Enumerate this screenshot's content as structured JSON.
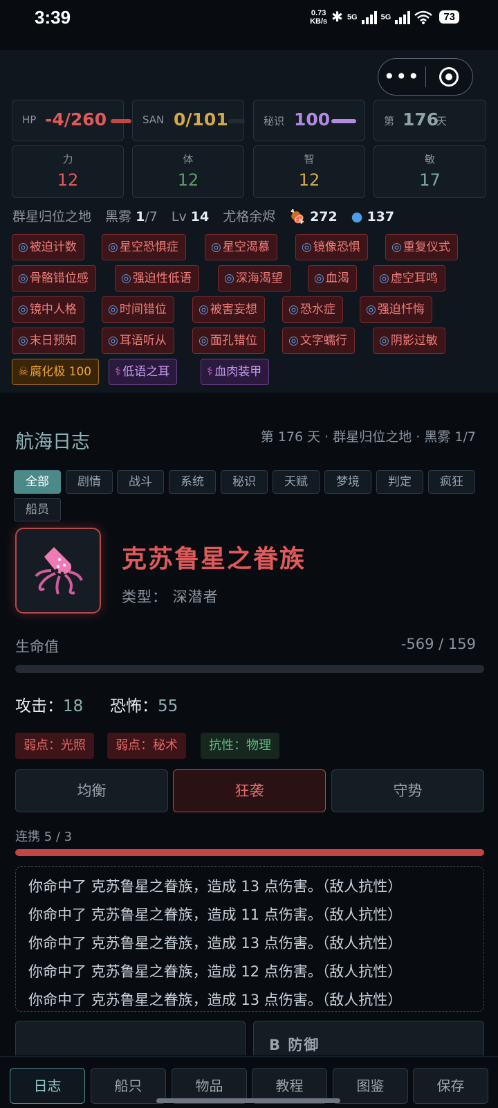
{
  "status_bar": {
    "time": "3:39",
    "net_speed_value": "0.73",
    "net_speed_unit": "KB/s",
    "sig1": "5G",
    "sig2": "5G",
    "battery": "73",
    "icons": [
      "bluetooth-icon",
      "signal-icon",
      "wifi-icon",
      "battery-icon"
    ]
  },
  "capsule": {
    "more_icon": "more-dots-icon",
    "close_icon": "target-icon"
  },
  "stats": {
    "hp": {
      "label": "HP",
      "value": "-4/260",
      "color": "#e05a5a"
    },
    "san": {
      "label": "SAN",
      "value": "0/101",
      "color": "#d4a94a"
    },
    "arcana": {
      "label": "秘识",
      "value": "100",
      "color": "#b489e0"
    },
    "day": {
      "prefix": "第",
      "value": "176",
      "suffix": "天"
    }
  },
  "attributes": [
    {
      "name": "力",
      "value": "12",
      "color": "#e05a5a"
    },
    {
      "name": "体",
      "value": "12",
      "color": "#5a9a6a"
    },
    {
      "name": "智",
      "value": "12",
      "color": "#d4a94a"
    },
    {
      "name": "敏",
      "value": "17",
      "color": "#7fa8a8"
    }
  ],
  "info": {
    "location": "群星归位之地",
    "fog_label": "黑雾",
    "fog_value": "1",
    "fog_max": "/7",
    "lv_label": "Lv",
    "lv_value": "14",
    "title": "尤格余烬",
    "food": "272",
    "water": "137"
  },
  "tags": [
    {
      "text": "被迫计数",
      "kind": "red"
    },
    {
      "text": "星空恐惧症",
      "kind": "red"
    },
    {
      "text": "星空渴慕",
      "kind": "red"
    },
    {
      "text": "镜像恐惧",
      "kind": "red"
    },
    {
      "text": "重复仪式",
      "kind": "red"
    },
    {
      "text": "骨骼错位感",
      "kind": "red"
    },
    {
      "text": "强迫性低语",
      "kind": "red"
    },
    {
      "text": "深海渴望",
      "kind": "red"
    },
    {
      "text": "血渴",
      "kind": "red"
    },
    {
      "text": "虚空耳鸣",
      "kind": "red"
    },
    {
      "text": "镜中人格",
      "kind": "red"
    },
    {
      "text": "时间错位",
      "kind": "red"
    },
    {
      "text": "被害妄想",
      "kind": "red"
    },
    {
      "text": "恐水症",
      "kind": "red"
    },
    {
      "text": "强迫忏悔",
      "kind": "red"
    },
    {
      "text": "末日预知",
      "kind": "red"
    },
    {
      "text": "耳语听从",
      "kind": "red"
    },
    {
      "text": "面孔错位",
      "kind": "red"
    },
    {
      "text": "文字蠕行",
      "kind": "red"
    },
    {
      "text": "阴影过敏",
      "kind": "red"
    },
    {
      "text": "腐化极 100",
      "kind": "orange"
    },
    {
      "text": "低语之耳",
      "kind": "purple"
    },
    {
      "text": "血肉装甲",
      "kind": "purple"
    }
  ],
  "log": {
    "title": "航海日志",
    "subtitle": "第 176 天 · 群星归位之地 · 黑雾 1/7",
    "filters": [
      "全部",
      "剧情",
      "战斗",
      "系统",
      "秘识",
      "天赋",
      "梦境",
      "判定",
      "疯狂",
      "船员"
    ],
    "active_filter": 0
  },
  "enemy": {
    "name": "克苏鲁星之眷族",
    "type_label": "类型：",
    "type_value": "深潜者",
    "icon": "squid-icon",
    "hp_label": "生命值",
    "hp_text": "-569 / 159",
    "hp_fraction": 0,
    "attack_label": "攻击：",
    "attack_value": "18",
    "fear_label": "恐怖：",
    "fear_value": "55",
    "traits": [
      {
        "text": "弱点：光照",
        "kind": "red"
      },
      {
        "text": "弱点：秘术",
        "kind": "red"
      },
      {
        "text": "抗性：物理",
        "kind": "green"
      }
    ]
  },
  "stances": [
    "均衡",
    "狂袭",
    "守势"
  ],
  "active_stance": 1,
  "combo": {
    "label": "连携 5 / 3",
    "fraction": 1
  },
  "combat_log": [
    "你命中了 克苏鲁星之眷族，造成 13 点伤害。（敌人抗性）",
    "你命中了 克苏鲁星之眷族，造成 11 点伤害。（敌人抗性）",
    "你命中了 克苏鲁星之眷族，造成 13 点伤害。（敌人抗性）",
    "你命中了 克苏鲁星之眷族，造成 12 点伤害。（敌人抗性）",
    "你命中了 克苏鲁星之眷族，造成 13 点伤害。（敌人抗性）"
  ],
  "actions": {
    "defend_label": "B  防御"
  },
  "nav": [
    "日志",
    "船只",
    "物品",
    "教程",
    "图鉴",
    "保存"
  ],
  "active_nav": 0
}
